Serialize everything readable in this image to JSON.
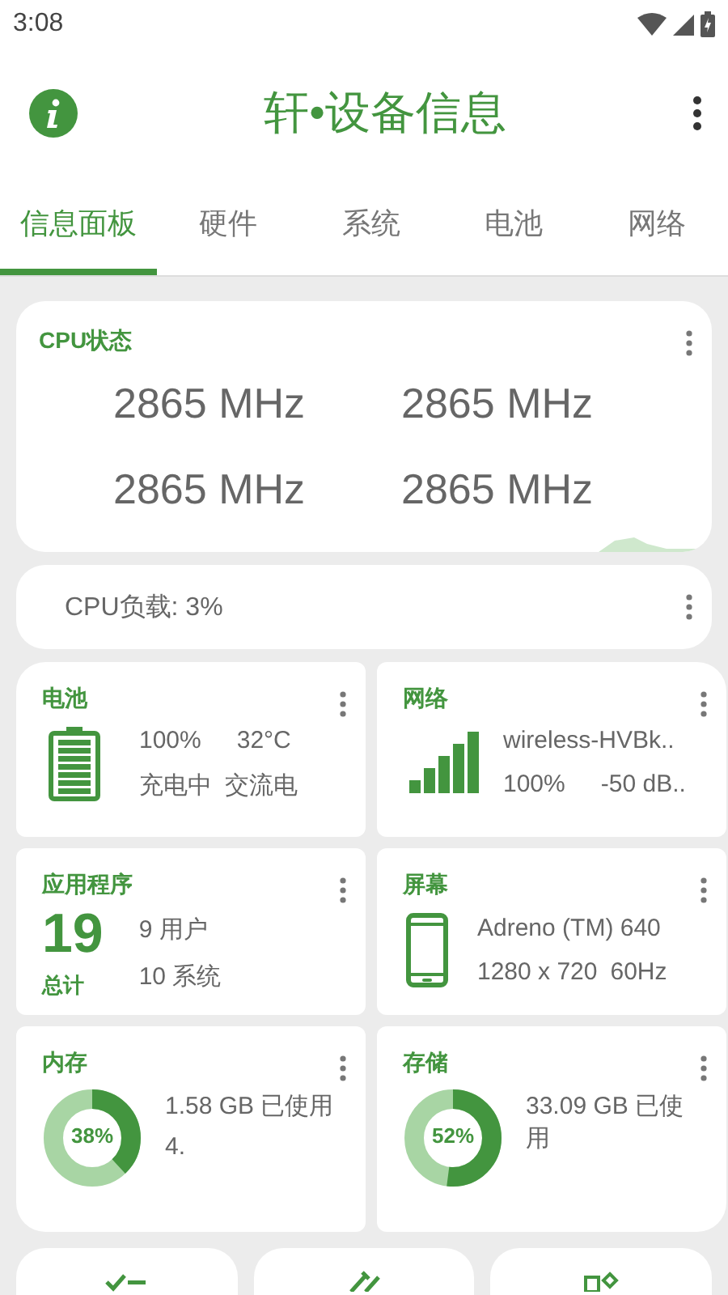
{
  "status_bar": {
    "time": "3:08"
  },
  "app_bar": {
    "title": "轩•设备信息"
  },
  "tabs": [
    {
      "label": "信息面板",
      "selected": true
    },
    {
      "label": "硬件",
      "selected": false
    },
    {
      "label": "系统",
      "selected": false
    },
    {
      "label": "电池",
      "selected": false
    },
    {
      "label": "网络",
      "selected": false
    }
  ],
  "cpu_card": {
    "title": "CPU状态",
    "frequencies": [
      "2865 MHz",
      "2865 MHz",
      "2865 MHz",
      "2865 MHz"
    ]
  },
  "cpu_load": {
    "text": "CPU负载: 3%"
  },
  "cards": [
    {
      "kind": "battery",
      "title": "电池",
      "value": "100%",
      "temperature": "32°C",
      "status": "充电中",
      "source": "交流电"
    },
    {
      "kind": "network",
      "title": "网络",
      "name": "wireless-HVBk..",
      "strength": "100%",
      "signal": "-50 dB.."
    },
    {
      "kind": "apps",
      "title": "应用程序",
      "total": "19",
      "total_label": "总计",
      "user": "9 用户",
      "system": "10 系统"
    },
    {
      "kind": "screen",
      "title": "屏幕",
      "gpu": "Adreno (TM) 640",
      "resolution": "1280 x 720",
      "refresh": "60Hz"
    },
    {
      "kind": "memory",
      "title": "内存",
      "percent": "38%",
      "level": 0.38,
      "used": "1.58 GB 已使用",
      "total": "4."
    },
    {
      "kind": "storage",
      "title": "存储",
      "percent": "52%",
      "level": 0.52,
      "used": "33.09 GB 已使用"
    }
  ],
  "bottom_cards": [
    {
      "kind": "checklist"
    },
    {
      "kind": "tools"
    },
    {
      "kind": "chip"
    }
  ]
}
